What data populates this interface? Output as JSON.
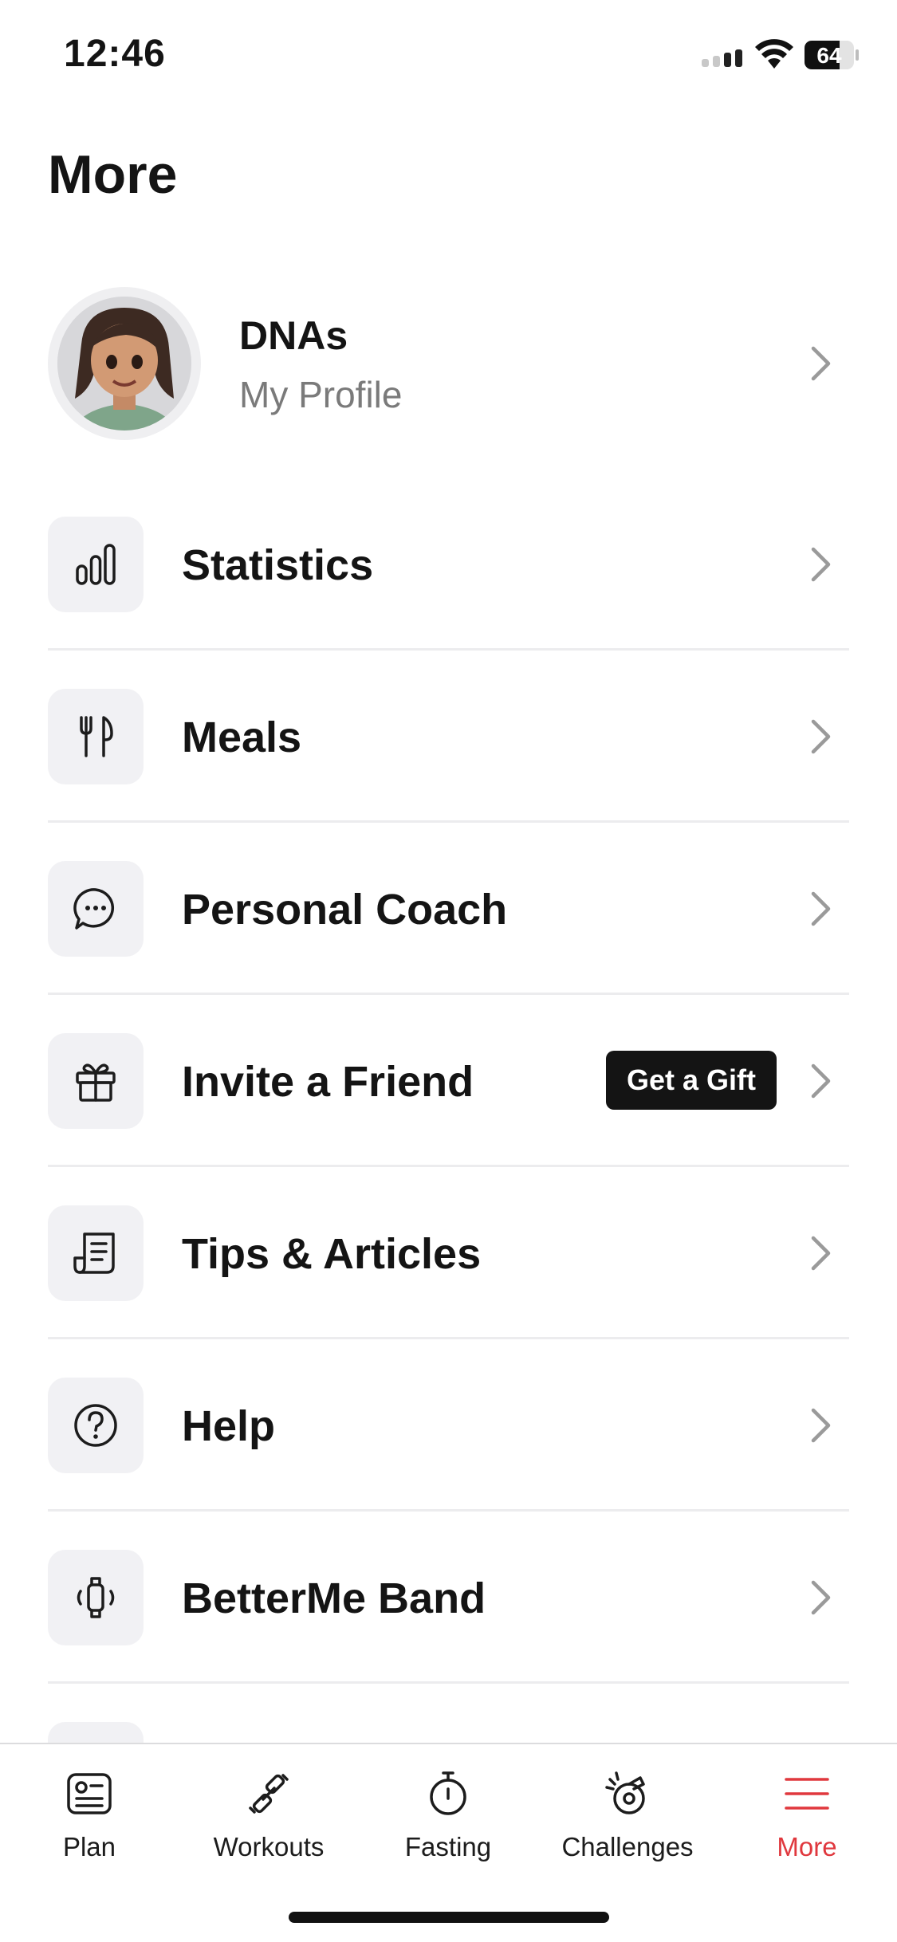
{
  "status_bar": {
    "time": "12:46",
    "battery": "64"
  },
  "header": {
    "title": "More"
  },
  "profile": {
    "name": "DNAs",
    "subtitle": "My Profile"
  },
  "menu": {
    "items": [
      {
        "label": "Statistics",
        "icon": "bar-chart-icon"
      },
      {
        "label": "Meals",
        "icon": "fork-knife-icon"
      },
      {
        "label": "Personal Coach",
        "icon": "chat-bubble-icon"
      },
      {
        "label": "Invite a Friend",
        "icon": "gift-icon",
        "badge": "Get a Gift"
      },
      {
        "label": "Tips & Articles",
        "icon": "article-icon"
      },
      {
        "label": "Help",
        "icon": "help-circle-icon"
      },
      {
        "label": "BetterMe Band",
        "icon": "band-icon"
      }
    ]
  },
  "tab_bar": {
    "tabs": [
      {
        "label": "Plan",
        "icon": "plan-icon"
      },
      {
        "label": "Workouts",
        "icon": "dumbbell-icon"
      },
      {
        "label": "Fasting",
        "icon": "stopwatch-icon"
      },
      {
        "label": "Challenges",
        "icon": "challenge-icon"
      },
      {
        "label": "More",
        "icon": "hamburger-icon",
        "active": true
      }
    ]
  },
  "colors": {
    "accent": "#e0383e",
    "text": "#141414",
    "muted": "#7a7a7a",
    "icon_bg": "#f1f1f4"
  }
}
